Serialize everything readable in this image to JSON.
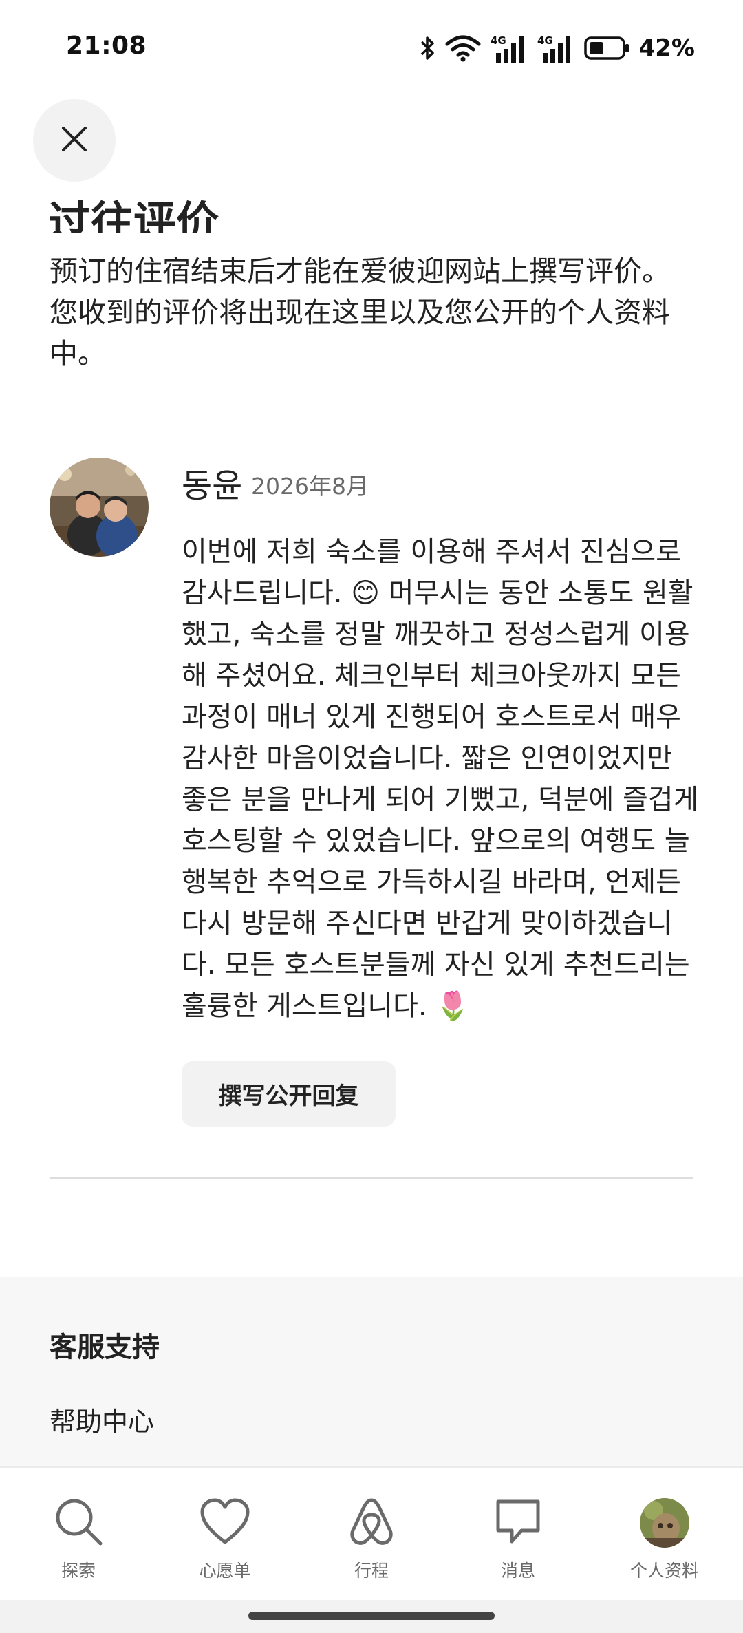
{
  "status_bar": {
    "time": "21:08",
    "battery": "42%",
    "icons": [
      "bluetooth-icon",
      "wifi-icon",
      "signal-4g-icon",
      "signal-4g-icon",
      "battery-icon"
    ]
  },
  "header": {
    "title": "过往评价",
    "intro": "预订的住宿结束后才能在爱彼迎网站上撰写评价。您收到的评价将出现在这里以及您公开的个人资料中。"
  },
  "review": {
    "name": "동윤",
    "date": "2026年8月",
    "text": "이번에 저희 숙소를 이용해 주셔서 진심으로 감사드립니다. 😊 머무시는 동안 소통도 원활했고, 숙소를 정말 깨끗하고 정성스럽게 이용해 주셨어요. 체크인부터 체크아웃까지 모든 과정이 매너 있게 진행되어 호스트로서 매우 감사한 마음이었습니다. 짧은 인연이었지만 좋은 분을 만나게 되어 기뻤고, 덕분에 즐겁게 호스팅할 수 있었습니다. 앞으로의 여행도 늘 행복한 추억으로 가득하시길 바라며, 언제든 다시 방문해 주신다면 반갑게 맞이하겠습니다. 모든 호스트분들께 자신 있게 추천드리는 훌륭한 게스트입니다. 🌷",
    "reply_button": "撰写公开回复"
  },
  "support": {
    "title": "客服支持",
    "link": "帮助中心"
  },
  "nav": {
    "items": [
      {
        "label": "探索",
        "icon": "search-icon"
      },
      {
        "label": "心愿单",
        "icon": "heart-icon"
      },
      {
        "label": "行程",
        "icon": "airbnb-logo-icon"
      },
      {
        "label": "消息",
        "icon": "message-icon"
      },
      {
        "label": "个人资料",
        "icon": "profile-avatar"
      }
    ]
  },
  "colors": {
    "text": "#222222",
    "muted": "#6a6a6a",
    "button_bg": "#f2f2f2",
    "support_bg": "#f7f7f7"
  }
}
